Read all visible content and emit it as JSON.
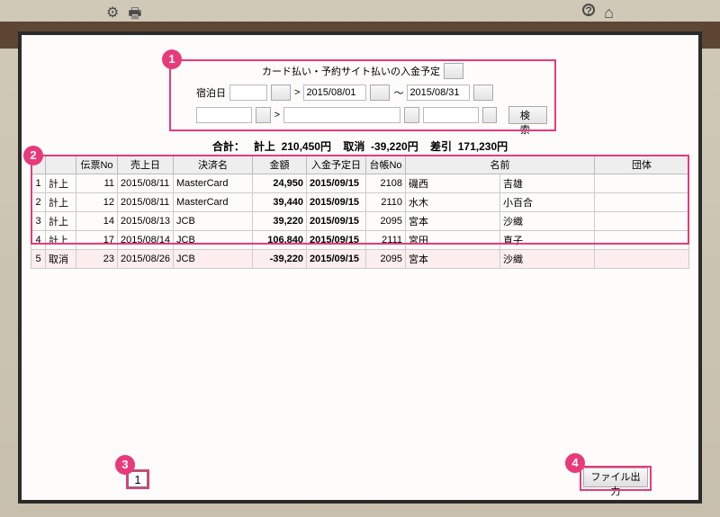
{
  "header": {
    "icons": {
      "gear": "⚙",
      "print": "🖶",
      "help": "?",
      "home": "⌂"
    }
  },
  "search": {
    "title": "カード払い・予約サイト払いの入金予定",
    "stay_label": "宿泊日",
    "gt": ">",
    "tilde": "～",
    "date_from": "2015/08/01",
    "date_to": "2015/08/31",
    "search_btn": "検 索"
  },
  "summary": {
    "label_total": "合計：",
    "label_keijo": "計上",
    "val_keijo": "210,450円",
    "label_cancel": "取消",
    "val_cancel": "-39,220円",
    "label_diff": "差引",
    "val_diff": "171,230円"
  },
  "columns": {
    "c0": "",
    "c1": "伝票No",
    "c2": "売上日",
    "c3": "決済名",
    "c4": "金額",
    "c5": "入金予定日",
    "c6": "台帳No",
    "c7": "名前",
    "c8": "団体"
  },
  "rows": [
    {
      "idx": "1",
      "status": "計上",
      "slip": "11",
      "date": "2015/08/11",
      "pay": "MasterCard",
      "amount": "24,950",
      "deposit": "2015/09/15",
      "ledger": "2108",
      "lname": "磯西",
      "fname": "吉雄",
      "group": "",
      "cancelled": false
    },
    {
      "idx": "2",
      "status": "計上",
      "slip": "12",
      "date": "2015/08/11",
      "pay": "MasterCard",
      "amount": "39,440",
      "deposit": "2015/09/15",
      "ledger": "2110",
      "lname": "水木",
      "fname": "小百合",
      "group": "",
      "cancelled": false
    },
    {
      "idx": "3",
      "status": "計上",
      "slip": "14",
      "date": "2015/08/13",
      "pay": "JCB",
      "amount": "39,220",
      "deposit": "2015/09/15",
      "ledger": "2095",
      "lname": "宮本",
      "fname": "沙織",
      "group": "",
      "cancelled": false
    },
    {
      "idx": "4",
      "status": "計上",
      "slip": "17",
      "date": "2015/08/14",
      "pay": "JCB",
      "amount": "106,840",
      "deposit": "2015/09/15",
      "ledger": "2111",
      "lname": "宮田",
      "fname": "直子",
      "group": "",
      "cancelled": false
    },
    {
      "idx": "5",
      "status": "取消",
      "slip": "23",
      "date": "2015/08/26",
      "pay": "JCB",
      "amount": "-39,220",
      "deposit": "2015/09/15",
      "ledger": "2095",
      "lname": "宮本",
      "fname": "沙織",
      "group": "",
      "cancelled": true
    }
  ],
  "footer": {
    "page": "1",
    "file_btn": "ファイル出力"
  },
  "callouts": {
    "c1": "1",
    "c2": "2",
    "c3": "3",
    "c4": "4"
  }
}
